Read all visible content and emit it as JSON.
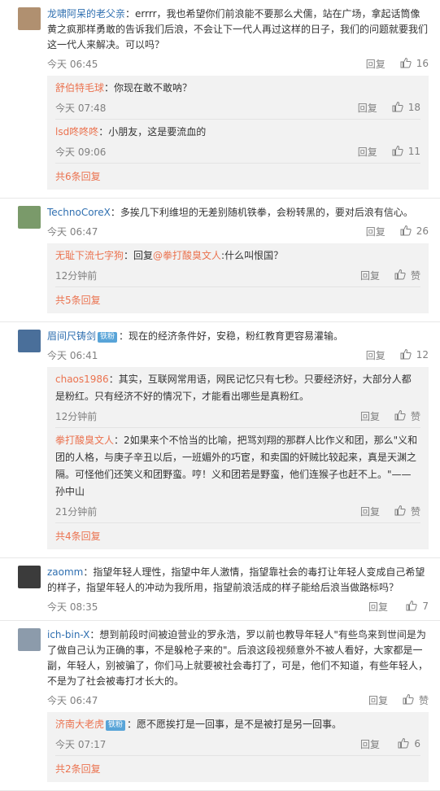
{
  "labels": {
    "reply": "回复",
    "like_fallback": "赞"
  },
  "comments": [
    {
      "user": "龙啸阿呆的老父亲",
      "text": "：errrr，我也希望你们前浪能不要那么犬儒，站在广场，拿起话筒像黄之疯那样勇敢的告诉我们后浪，不会让下一代人再过这样的日子，我们的问题就要我们这一代人来解决。可以吗？",
      "time": "今天 06:45",
      "likes": "16",
      "replies": [
        {
          "user": "舒伯特毛球",
          "text": "：你现在敢不敢呐？",
          "time": "今天 07:48",
          "likes": "18"
        },
        {
          "user": "lsd咚咚咚",
          "text": "：小朋友，这是要流血的",
          "time": "今天 09:06",
          "likes": "11"
        }
      ],
      "more": "共6条回复"
    },
    {
      "user": "TechnoCoreX",
      "text": "：多挨几下利维坦的无差别随机铁拳，会粉转黑的，要对后浪有信心。",
      "time": "今天 06:47",
      "likes": "26",
      "replies": [
        {
          "user": "无耻下流七字狗",
          "prefix": "：回复",
          "mention": "@拳打酸臭文人",
          "text": ":什么叫恨国？",
          "time": "12分钟前",
          "likes": "赞"
        }
      ],
      "more": "共5条回复"
    },
    {
      "user": "眉间尺铸剑",
      "badge": "铁粉",
      "text": "：现在的经济条件好，安稳，粉红教育更容易灌输。",
      "time": "今天 06:41",
      "likes": "12",
      "replies": [
        {
          "user": "chaos1986",
          "text": "：其实，互联网常用语，网民记忆只有七秒。只要经济好，大部分人都是粉红。只有经济不好的情况下，才能看出哪些是真粉红。",
          "time": "12分钟前",
          "likes": "赞"
        },
        {
          "user": "拳打酸臭文人",
          "text": "：2如果来个不恰当的比喻，把骂刘翔的那群人比作义和团，那么\"义和团的人格，与庚子辛丑以后，一班媚外的巧宦，和卖国的奸贼比较起来，真是天渊之隔。可怪他们还笑义和团野蛮。哼！义和团若是野蛮，他们连猴子也赶不上。\"——孙中山",
          "time": "21分钟前",
          "likes": "赞"
        }
      ],
      "more": "共4条回复"
    },
    {
      "user": "zaomm",
      "text": "：指望年轻人理性，指望中年人激情，指望靠社会的毒打让年轻人变成自己希望的样子，指望年轻人的冲动为我所用，指望前浪活成的样子能给后浪当做路标吗？",
      "time": "今天 08:35",
      "likes": "7",
      "replies": []
    },
    {
      "user": "ich-bin-X",
      "text": "：想到前段时间被迫营业的罗永浩，罗以前也教导年轻人\"有些鸟来到世间是为了做自己认为正确的事，不是躲枪子来的\"。后浪这段视频意外不被人看好，大家都是一副，年轻人，别被骗了，你们马上就要被社会毒打了，可是，他们不知道，有些年轻人，不是为了社会被毒打才长大的。",
      "time": "今天 06:47",
      "likes": "赞",
      "replies": [
        {
          "user": "济南大老虎",
          "badge": "铁粉",
          "text": "：愿不愿挨打是一回事，是不是被打是另一回事。",
          "time": "今天 07:17",
          "likes": "6"
        }
      ],
      "more": "共2条回复"
    }
  ]
}
